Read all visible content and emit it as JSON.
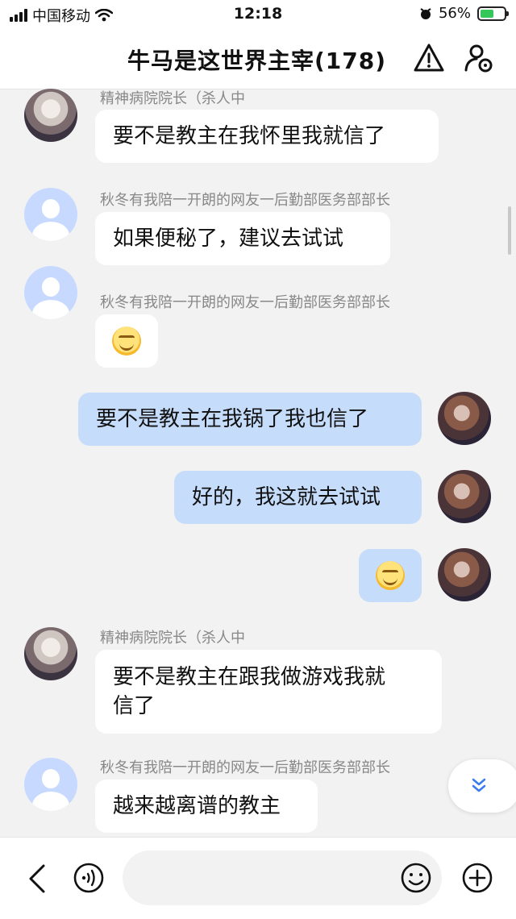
{
  "status_bar": {
    "carrier": "中国移动",
    "time": "12:18",
    "battery": "56%",
    "battery_level": 0.56
  },
  "header": {
    "title": "牛马是这世界主宰(178)",
    "warning_icon": "warning-triangle-icon",
    "settings_icon": "group-settings-icon"
  },
  "messages": [
    {
      "sender": "精神病院院长（杀人中",
      "text": "要不是教主在我怀里我就信了",
      "mine": false
    },
    {
      "sender": "秋冬有我陪一开朗的网友一后勤部医务部部长",
      "text": "如果便秘了，建议去试试",
      "mine": false
    },
    {
      "sender": "秋冬有我陪一开朗的网友一后勤部医务部部长",
      "emoji": "grin-emoji",
      "mine": false
    },
    {
      "text": "要不是教主在我锅了我也信了",
      "mine": true
    },
    {
      "text": "好的，我这就去试试",
      "mine": true
    },
    {
      "emoji": "grin-emoji",
      "mine": true
    },
    {
      "sender": "精神病院院长（杀人中",
      "text_line1": "要不是教主在跟我做游戏我就",
      "text_line2": "信了",
      "mine": false
    },
    {
      "sender": "秋冬有我陪一开朗的网友一后勤部医务部部长",
      "text": "越来越离谱的教主",
      "mine": false
    }
  ],
  "input_bar": {
    "placeholder": "",
    "icons": [
      "back-chevron-icon",
      "voice-icon",
      "emoji-icon",
      "plus-icon"
    ]
  },
  "colors": {
    "mine_bubble": "#c6dcfb",
    "other_bubble": "#ffffff",
    "background": "#f2f2f2"
  }
}
